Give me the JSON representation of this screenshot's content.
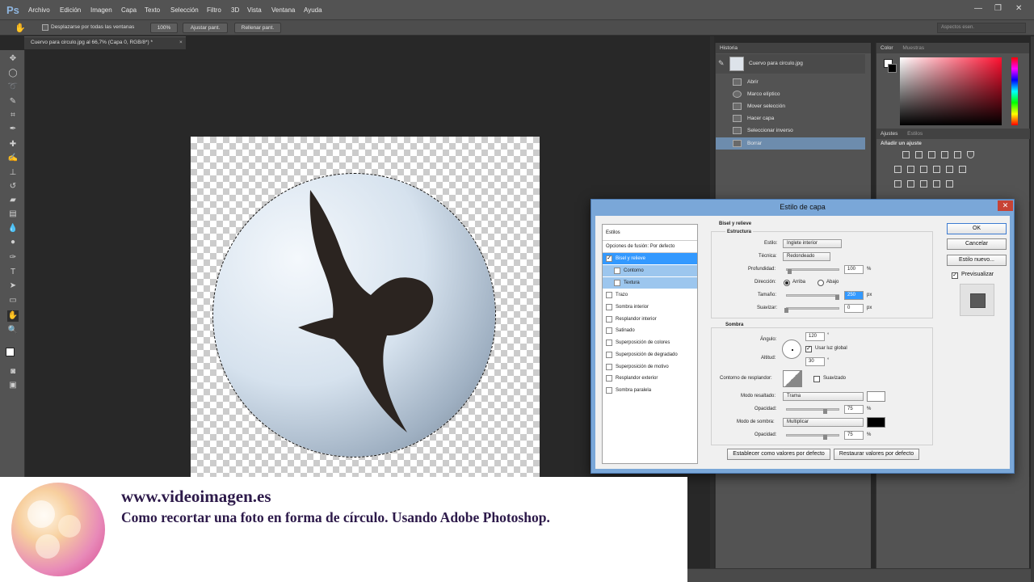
{
  "app": {
    "logo": "Ps"
  },
  "menu": [
    "Archivo",
    "Edición",
    "Imagen",
    "Capa",
    "Texto",
    "Selección",
    "Filtro",
    "3D",
    "Vista",
    "Ventana",
    "Ayuda"
  ],
  "options": {
    "scroll_all_label": "Desplazarse por todas las ventanas",
    "zoom_btn": "100%",
    "fit_btn": "Ajustar pant.",
    "fill_btn": "Rellenar pant.",
    "workspace": "Aspectos esen."
  },
  "document_tab": {
    "title": "Cuervo para circulo.jpg al 66,7% (Capa 0, RGB/8*) *",
    "close": "×"
  },
  "history": {
    "tab": "Historia",
    "snapshot": "Cuervo para circulo.jpg",
    "items": [
      "Abrir",
      "Marco elíptico",
      "Mover selección",
      "Hacer capa",
      "Seleccionar inverso",
      "Borrar"
    ]
  },
  "color_panel": {
    "tabs": [
      "Color",
      "Muestras"
    ]
  },
  "adjust_panel": {
    "tabs": [
      "Ajustes",
      "Estilos"
    ],
    "heading": "Añadir un ajuste"
  },
  "dialog": {
    "title": "Estilo de capa",
    "close": "✕",
    "styles_header": "Estilos",
    "blend_options": "Opciones de fusión: Por defecto",
    "style_items": [
      {
        "label": "Bisel y relieve",
        "checked": true
      },
      {
        "label": "Contorno",
        "checked": false
      },
      {
        "label": "Textura",
        "checked": false
      },
      {
        "label": "Trazo",
        "checked": false
      },
      {
        "label": "Sombra interior",
        "checked": false
      },
      {
        "label": "Resplandor interior",
        "checked": false
      },
      {
        "label": "Satinado",
        "checked": false
      },
      {
        "label": "Superposición de colores",
        "checked": false
      },
      {
        "label": "Superposición de degradado",
        "checked": false
      },
      {
        "label": "Superposición de motivo",
        "checked": false
      },
      {
        "label": "Resplandor exterior",
        "checked": false
      },
      {
        "label": "Sombra paralela",
        "checked": false
      }
    ],
    "section_title": "Bisel y relieve",
    "structure": {
      "title": "Estructura",
      "style_label": "Estilo:",
      "style_value": "Inglete interior",
      "technique_label": "Técnica:",
      "technique_value": "Redondeado",
      "depth_label": "Profundidad:",
      "depth_value": "100",
      "depth_unit": "%",
      "direction_label": "Dirección:",
      "dir_up": "Arriba",
      "dir_down": "Abajo",
      "size_label": "Tamaño:",
      "size_value": "250",
      "size_unit": "px",
      "soften_label": "Suavizar:",
      "soften_value": "0",
      "soften_unit": "px"
    },
    "shading": {
      "title": "Sombra",
      "angle_label": "Ángulo:",
      "angle_value": "120",
      "angle_unit": "°",
      "global_light": "Usar luz global",
      "altitude_label": "Altitud:",
      "altitude_value": "30",
      "altitude_unit": "°",
      "contour_label": "Contorno de resplandor:",
      "antialias": "Suavizado",
      "highlight_mode_label": "Modo resaltado:",
      "highlight_mode": "Trama",
      "highlight_opacity_label": "Opacidad:",
      "highlight_opacity": "75",
      "highlight_opacity_unit": "%",
      "shadow_mode_label": "Modo de sombra:",
      "shadow_mode": "Multiplicar",
      "shadow_opacity_label": "Opacidad:",
      "shadow_opacity": "75",
      "shadow_opacity_unit": "%"
    },
    "make_default": "Establecer como valores por defecto",
    "reset_default": "Restaurar valores por defecto",
    "ok": "OK",
    "cancel": "Cancelar",
    "new_style": "Estilo nuevo...",
    "preview": "Previsualizar"
  },
  "caption": {
    "url": "www.videoimagen.es",
    "text": "Como recortar una foto en forma de círculo. Usando Adobe Photoshop."
  },
  "colors": {
    "highlight": "#ffffff",
    "shadow": "#000000",
    "accent": "#3399ff"
  }
}
